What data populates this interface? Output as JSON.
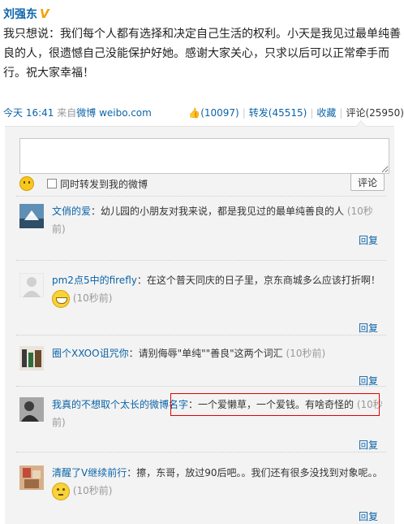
{
  "post": {
    "author": "刘强东",
    "verified_badge": "V",
    "text": "我只想说：我们每个人都有选择和决定自己生活的权利。小天是我见过最单纯善良的人，很遗憾自己没能保护好她。感谢大家关心，只求以后可以正常牵手而行。祝大家幸福！",
    "time": "今天  16:41",
    "source_prefix": "来自",
    "source_name": "微博",
    "source_domain": "weibo.com",
    "likes": "(10097)",
    "repost": "转发(45515)",
    "favorite": "收藏",
    "comment": "评论(25950)"
  },
  "composer": {
    "checkbox_label": "同时转发到我的微博",
    "submit_label": "评论"
  },
  "comments": [
    {
      "user": "文俏的爱",
      "text": "：幼儿园的小朋友对我来说，都是我见过的最单纯善良的人",
      "time": "(10秒前)",
      "reply": "回复"
    },
    {
      "user": "pm2点5中的firefly",
      "text": "：在这个普天同庆的日子里，京东商城多么应该打折啊！",
      "time": "(10秒前)",
      "reply": "回复"
    },
    {
      "user": "圈个XXOO诅咒你",
      "text": "：请别侮辱\"单纯\"\"善良\"这两个词汇",
      "time": "(10秒前)",
      "reply": "回复"
    },
    {
      "user": "我真的不想取个太长的微博名字",
      "text": "：一个爱懒草，一个爱钱。有啥奇怪的",
      "time": "(10秒前)",
      "reply": "回复"
    },
    {
      "user": "清醒了V继续前行",
      "text": "：擦，东哥，放过90后吧。。我们还有很多没找到对象呢。。",
      "time": "(10秒前)",
      "reply": "回复"
    }
  ],
  "colors": {
    "link": "#0a64a8",
    "highlight": "#e00000",
    "panel_bg": "#f3f3f3"
  }
}
